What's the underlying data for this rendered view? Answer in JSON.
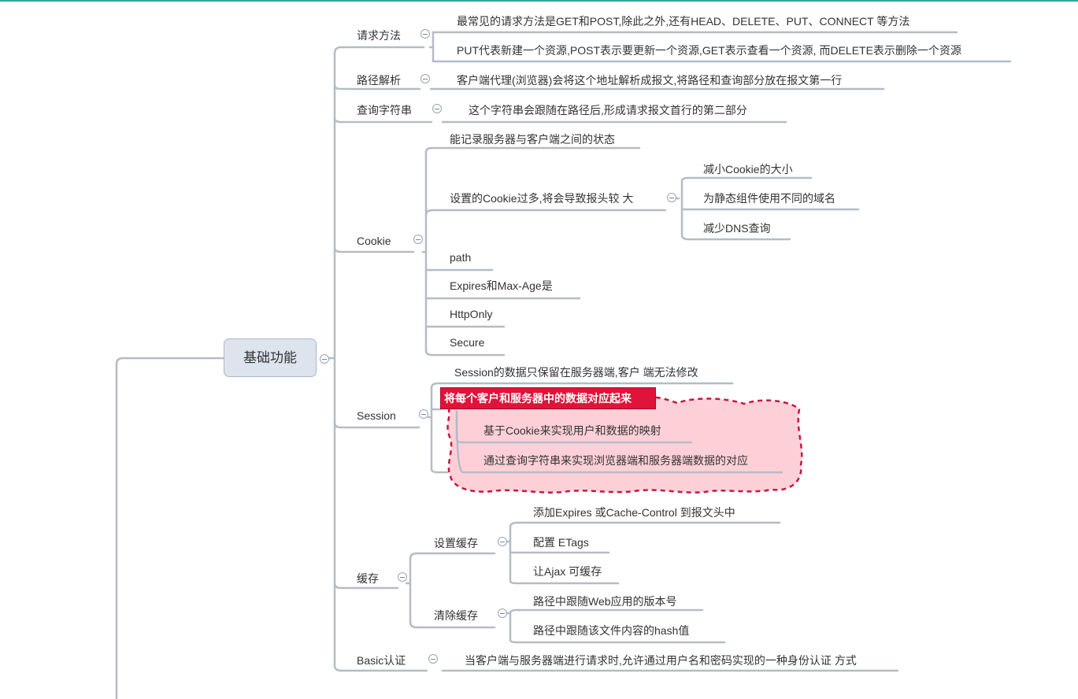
{
  "root": "基础功能",
  "branches": {
    "request_method": {
      "label": "请求方法",
      "items": [
        "最常见的请求方法是GET和POST,除此之外,还有HEAD、DELETE、PUT、CONNECT 等方法",
        "PUT代表新建一个资源,POST表示要更新一个资源,GET表示查看一个资源, 而DELETE表示删除一个资源"
      ]
    },
    "path_parse": {
      "label": "路径解析",
      "items": [
        "客户端代理(浏览器)会将这个地址解析成报文,将路径和查询部分放在报文第一行"
      ]
    },
    "query_string": {
      "label": "查询字符串",
      "items": [
        "这个字符串会跟随在路径后,形成请求报文首行的第二部分"
      ]
    },
    "cookie": {
      "label": "Cookie",
      "items": [
        "能记录服务器与客户端之间的状态",
        "设置的Cookie过多,将会导致报头较 大",
        "path",
        "Expires和Max-Age是",
        "HttpOnly",
        "Secure"
      ],
      "too_many_children": [
        "减小Cookie的大小",
        "为静态组件使用不同的域名",
        "减少DNS查询"
      ]
    },
    "session": {
      "label": "Session",
      "items": [
        "Session的数据只保留在服务器端,客户 端无法修改",
        "将每个客户和服务器中的数据对应起来"
      ],
      "mapping_children": [
        "基于Cookie来实现用户和数据的映射",
        "通过查询字符串来实现浏览器端和服务器端数据的对应"
      ]
    },
    "cache": {
      "label": "缓存",
      "set": {
        "label": "设置缓存",
        "items": [
          "添加Expires 或Cache-Control 到报文头中",
          "配置 ETags",
          "让Ajax 可缓存"
        ]
      },
      "clear": {
        "label": "清除缓存",
        "items": [
          "路径中跟随Web应用的版本号",
          "路径中跟随该文件内容的hash值"
        ]
      }
    },
    "basic_auth": {
      "label": "Basic认证",
      "items": [
        "当客户端与服务器端进行请求时,允许通过用户名和密码实现的一种身份认证 方式"
      ]
    }
  },
  "colors": {
    "line": "#b4bcc6",
    "highlight": "#e0133a",
    "cloud_fill": "#fdd0d8",
    "cloud_border": "#c8173f",
    "accent_bar": "#3aa39a"
  }
}
